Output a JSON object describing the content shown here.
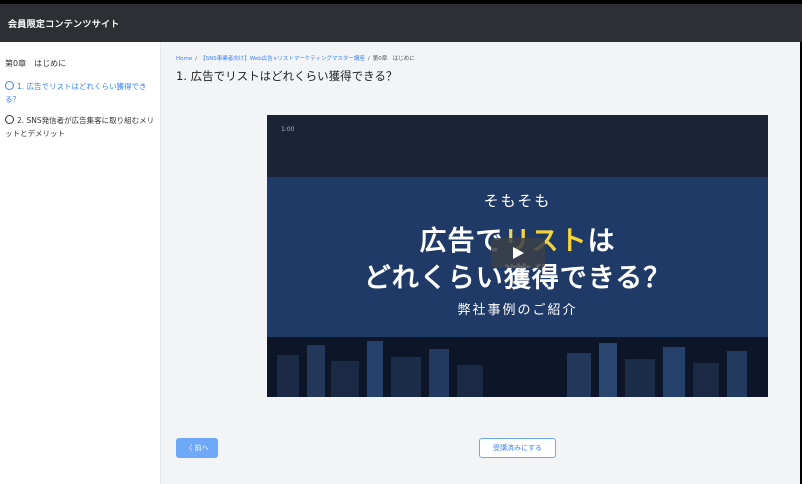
{
  "header": {
    "site_title": "会員限定コンテンツサイト"
  },
  "sidebar": {
    "chapter_heading": "第0章　はじめに",
    "lessons": [
      {
        "label": "1. 広告でリストはどれくらい獲得できる？",
        "active": true
      },
      {
        "label": "2. SNS発信者が広告集客に取り組むメリットとデメリット",
        "active": false
      }
    ]
  },
  "breadcrumb": {
    "home": "Home",
    "course": "【SNS事業者向け】Web広告×リストマーケティングマスター講座",
    "current": "第0章　はじめに"
  },
  "page_title": "1. 広告でリストはどれくらい獲得できる？",
  "video": {
    "time": "1:00",
    "subheading": "そもそも",
    "line1_a": "広告で",
    "line1_highlight": "リスト",
    "line1_b": "は",
    "line2": "どれくらい獲得できる？",
    "caption": "弊社事例のご紹介"
  },
  "buttons": {
    "prev": "〈 前へ",
    "complete": "受講済みにする"
  },
  "colors": {
    "accent": "#3b82f6",
    "header_bg": "#2c2f33",
    "highlight": "#f5d33a"
  }
}
